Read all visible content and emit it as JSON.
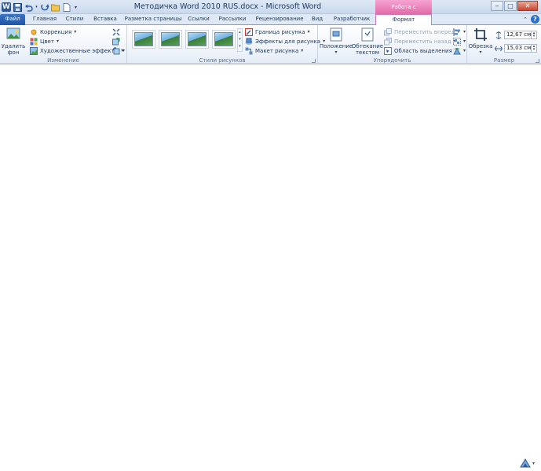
{
  "title_bar": {
    "title": "Методичка Word 2010 RUS.docx - Microsoft Word",
    "context_header": "Работа с рисунками",
    "qat_items": [
      "word-icon",
      "save-icon",
      "undo-icon",
      "redo-icon",
      "open-folder-icon",
      "new-document-icon",
      "customize-qat-icon"
    ],
    "window_controls": {
      "minimize": "‒",
      "maximize": "□",
      "close": "✕"
    }
  },
  "tabs": {
    "file": "Файл",
    "home": "Главная",
    "styles": "Стили",
    "insert": "Вставка",
    "page_layout": "Разметка страницы",
    "references": "Ссылки",
    "mailings": "Рассылки",
    "review": "Рецензирование",
    "view": "Вид",
    "developer": "Разработчик",
    "format": "Формат"
  },
  "ribbon": {
    "adjust": {
      "label": "Изменение",
      "remove_bg_line1": "Удалить",
      "remove_bg_line2": "фон",
      "correction": "Коррекция",
      "color": "Цвет",
      "artistic_effects": "Художественные эффекты"
    },
    "picture_styles": {
      "label": "Стили рисунков",
      "border": "Граница рисунка",
      "effects": "Эффекты для рисунка",
      "layout": "Макет рисунка"
    },
    "arrange": {
      "label": "Упорядочить",
      "position": "Положение",
      "wrap_line1": "Обтекание",
      "wrap_line2": "текстом",
      "bring_forward": "Переместить вперед",
      "send_backward": "Переместить назад",
      "selection_pane": "Область выделения"
    },
    "size": {
      "label": "Размер",
      "crop": "Обрезка",
      "height": "12,67 см",
      "width": "15,03 см"
    }
  },
  "colors": {
    "accent_pink": "#e26aa8",
    "file_blue": "#1e55a6",
    "ribbon_text": "#1f3b60"
  }
}
